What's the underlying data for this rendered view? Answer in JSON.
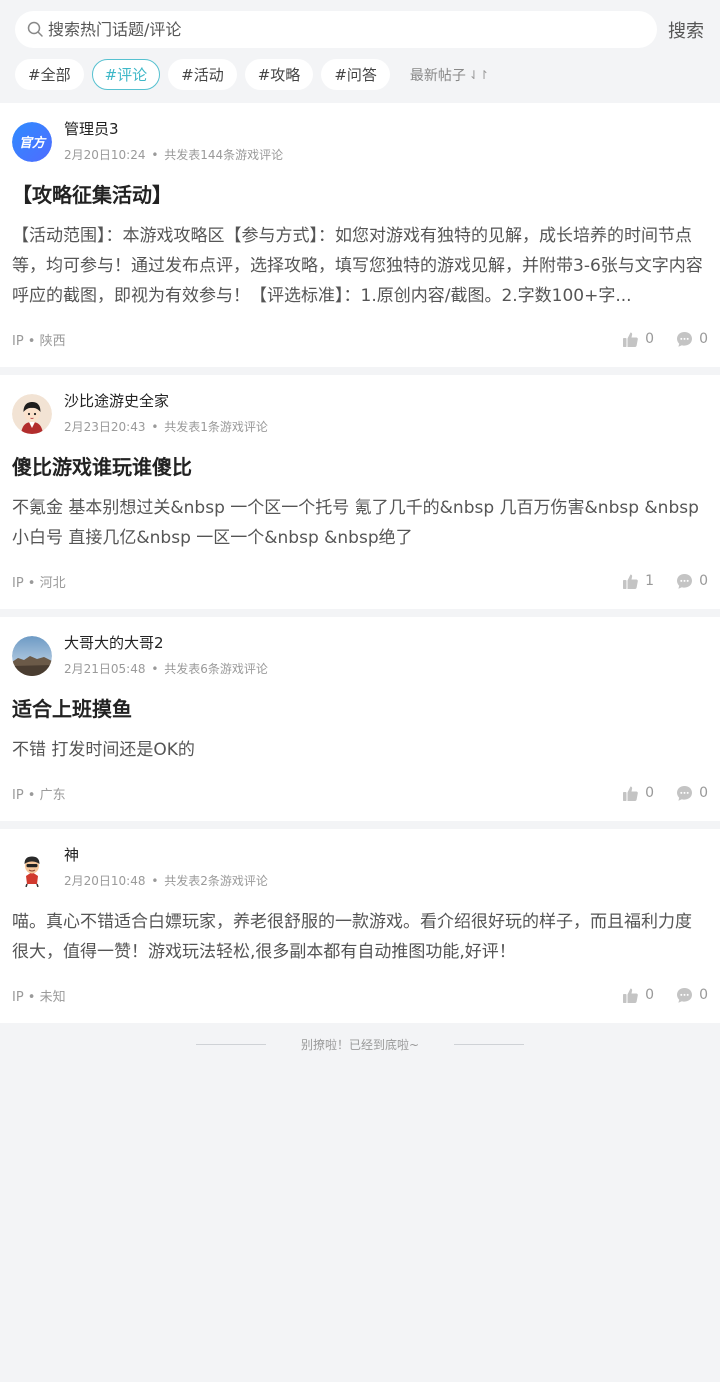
{
  "search": {
    "placeholder": "搜索热门话题/评论",
    "button_label": "搜索"
  },
  "tabs": [
    {
      "label": "#全部",
      "active": false
    },
    {
      "label": "#评论",
      "active": true
    },
    {
      "label": "#活动",
      "active": false
    },
    {
      "label": "#攻略",
      "active": false
    },
    {
      "label": "#问答",
      "active": false
    }
  ],
  "sort": {
    "label": "最新帖子",
    "icon": "sort-arrows-icon"
  },
  "accent_color": "#3fb8c8",
  "posts": [
    {
      "username": "管理员3",
      "date": "2月20日10:24",
      "sep": "•",
      "count_text": "共发表144条游戏评论",
      "title": "【攻略征集活动】",
      "body": "【活动范围】：本游戏攻略区【参与方式】：如您对游戏有独特的见解，成长培养的时间节点等，均可参与！通过发布点评，选择攻略，填写您独特的游戏见解，并附带3-6张与文字内容呼应的截图，即视为有效参与！【评选标准】：1.原创内容/截图。2.字数100+字...",
      "ip": "IP • 陕西",
      "likes": "0",
      "comments": "0",
      "avatar_text": "官方"
    },
    {
      "username": "沙比途游史全家",
      "date": "2月23日20:43",
      "sep": "•",
      "count_text": "共发表1条游戏评论",
      "title": "傻比游戏谁玩谁傻比",
      "body": "不氪金 基本别想过关&nbsp 一个区一个托号 氪了几千的&nbsp 几百万伤害&nbsp &nbsp小白号 直接几亿&nbsp 一区一个&nbsp &nbsp绝了",
      "ip": "IP • 河北",
      "likes": "1",
      "comments": "0"
    },
    {
      "username": "大哥大的大哥2",
      "date": "2月21日05:48",
      "sep": "•",
      "count_text": "共发表6条游戏评论",
      "title": "适合上班摸鱼",
      "body": "不错 打发时间还是OK的",
      "ip": "IP • 广东",
      "likes": "0",
      "comments": "0"
    },
    {
      "username": "神",
      "date": "2月20日10:48",
      "sep": "•",
      "count_text": "共发表2条游戏评论",
      "title": "",
      "body": "喵。真心不错适合白嫖玩家，养老很舒服的一款游戏。看介绍很好玩的样子，而且福利力度很大，值得一赞！游戏玩法轻松,很多副本都有自动推图功能,好评！",
      "ip": "IP • 未知",
      "likes": "0",
      "comments": "0"
    }
  ],
  "footer": {
    "end_text": "别撩啦！已经到底啦~"
  }
}
